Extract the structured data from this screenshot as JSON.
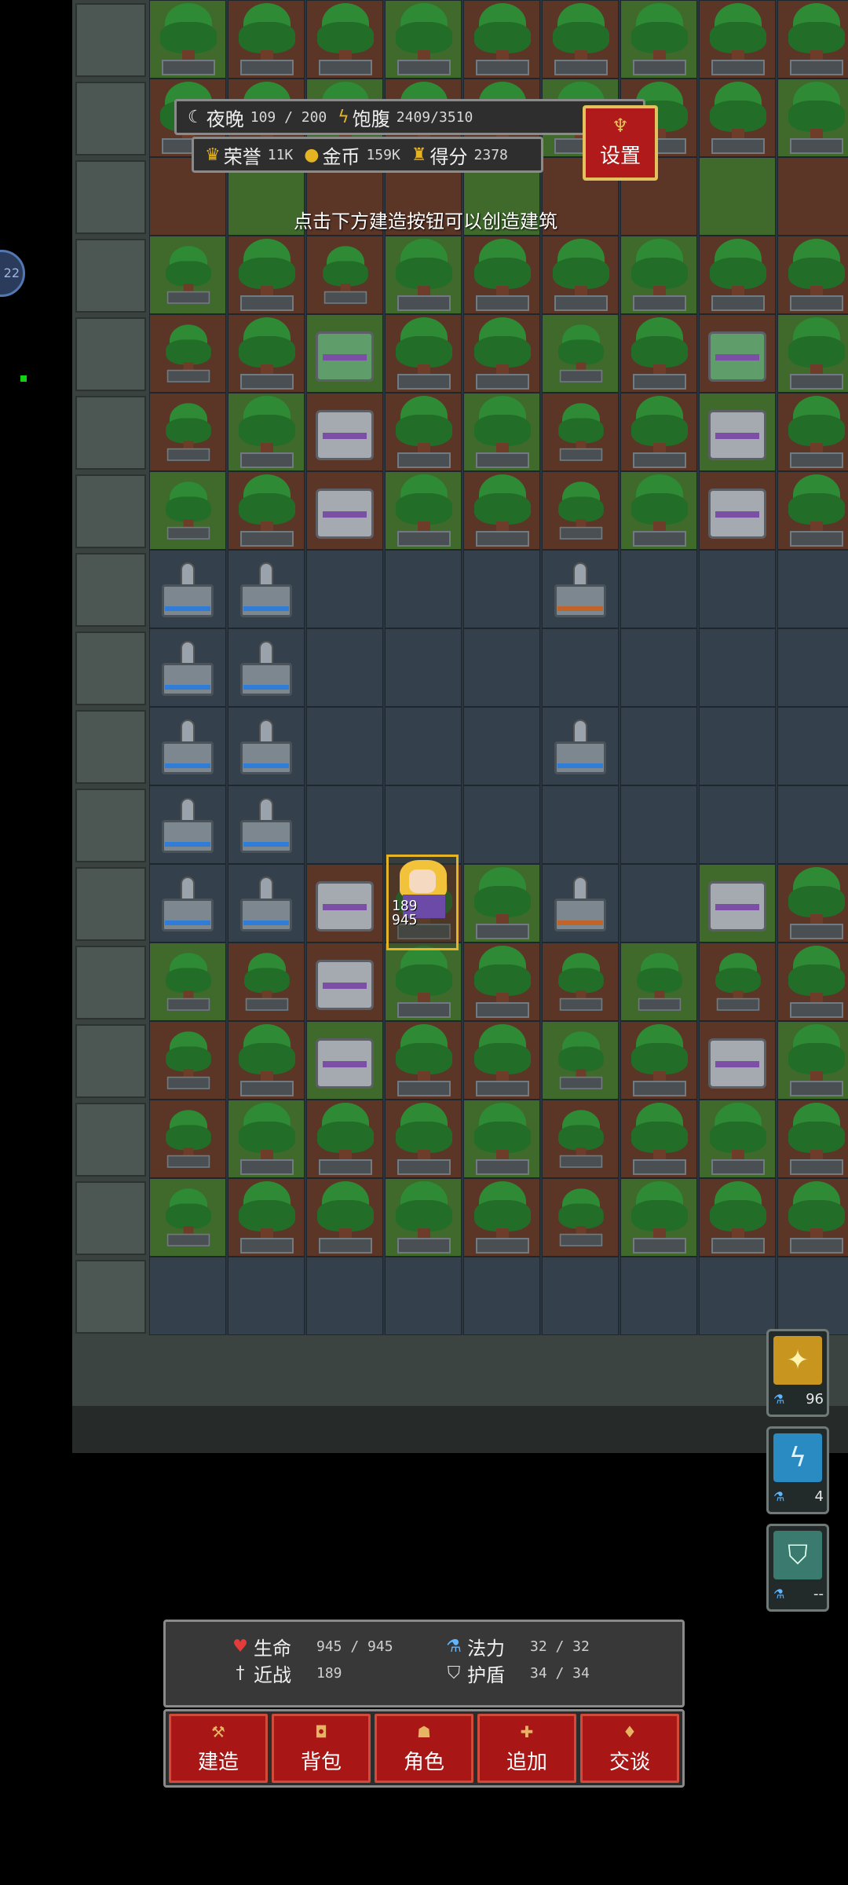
{
  "hud": {
    "night_label": "夜晚",
    "night_value": "109 / 200",
    "fullness_label": "饱腹",
    "fullness_value": "2409/3510",
    "honor_label": "荣誉",
    "honor_value": "11K",
    "gold_label": "金币",
    "gold_value": "159K",
    "score_label": "得分",
    "score_value": "2378",
    "settings_label": "设置",
    "hint": "点击下方建造按钮可以创造建筑"
  },
  "side_badge": "22",
  "hero": {
    "stat_top": "189",
    "stat_bottom": "945"
  },
  "skills": [
    {
      "icon": "golden-burst-icon",
      "cost": "96"
    },
    {
      "icon": "lightning-icon",
      "cost": "4"
    },
    {
      "icon": "shield-icon",
      "cost": "--"
    }
  ],
  "status": {
    "hp_label": "生命",
    "hp_value": "945 / 945",
    "mana_label": "法力",
    "mana_value": "32 / 32",
    "melee_label": "近战",
    "melee_value": "189",
    "shield_label": "护盾",
    "shield_value": "34 / 34"
  },
  "actions": {
    "build": "建造",
    "bag": "背包",
    "role": "角色",
    "add": "追加",
    "talk": "交谈"
  },
  "colors": {
    "button_red": "#a81616",
    "gold_border": "#e2c25c",
    "mana_blue": "#5fb6ff"
  }
}
